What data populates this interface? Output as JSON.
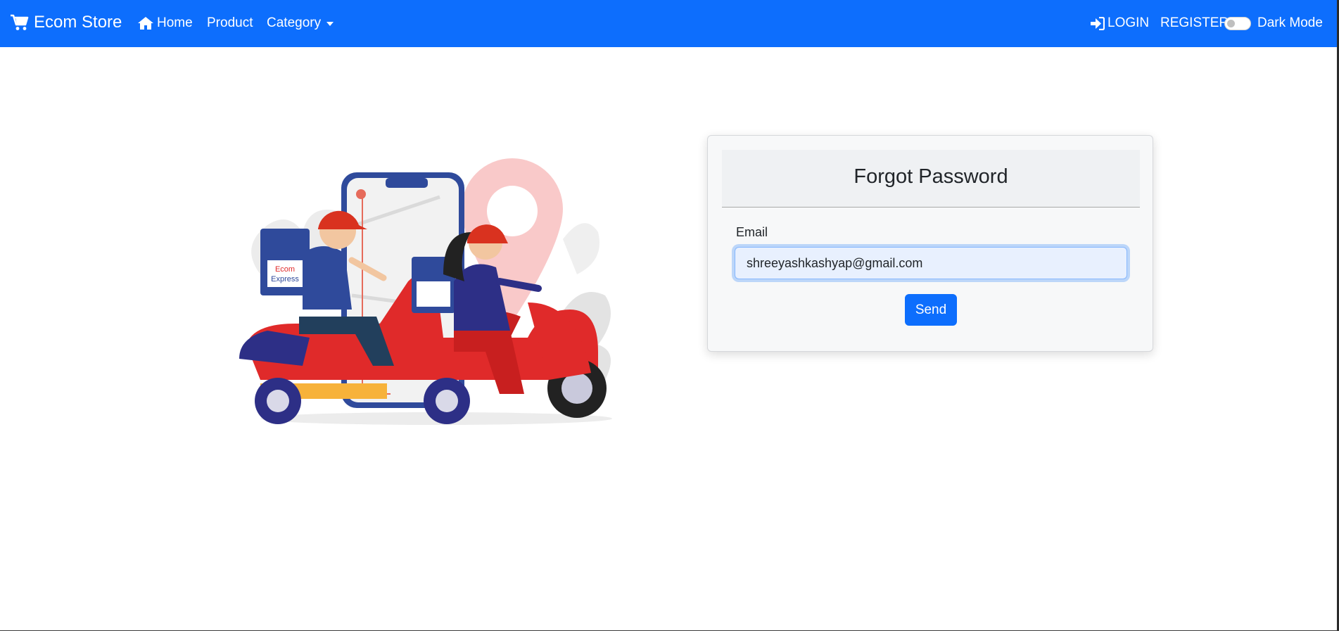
{
  "navbar": {
    "brand": "Ecom Store",
    "brand_icon": "cart-icon",
    "home": "Home",
    "home_icon": "home-icon",
    "product": "Product",
    "category": "Category",
    "login": "LOGIN",
    "login_icon": "sign-in-icon",
    "register": "REGISTER",
    "dark_mode": "Dark Mode",
    "dark_mode_enabled": false,
    "background_color": "#0d6efd"
  },
  "illustration": {
    "box_text_line1": "Ecom",
    "box_text_line2": "Express"
  },
  "form": {
    "title": "Forgot Password",
    "email_label": "Email",
    "email_value": "shreeyashkashyap@gmail.com",
    "send_label": "Send",
    "accent_color": "#0d6efd"
  }
}
